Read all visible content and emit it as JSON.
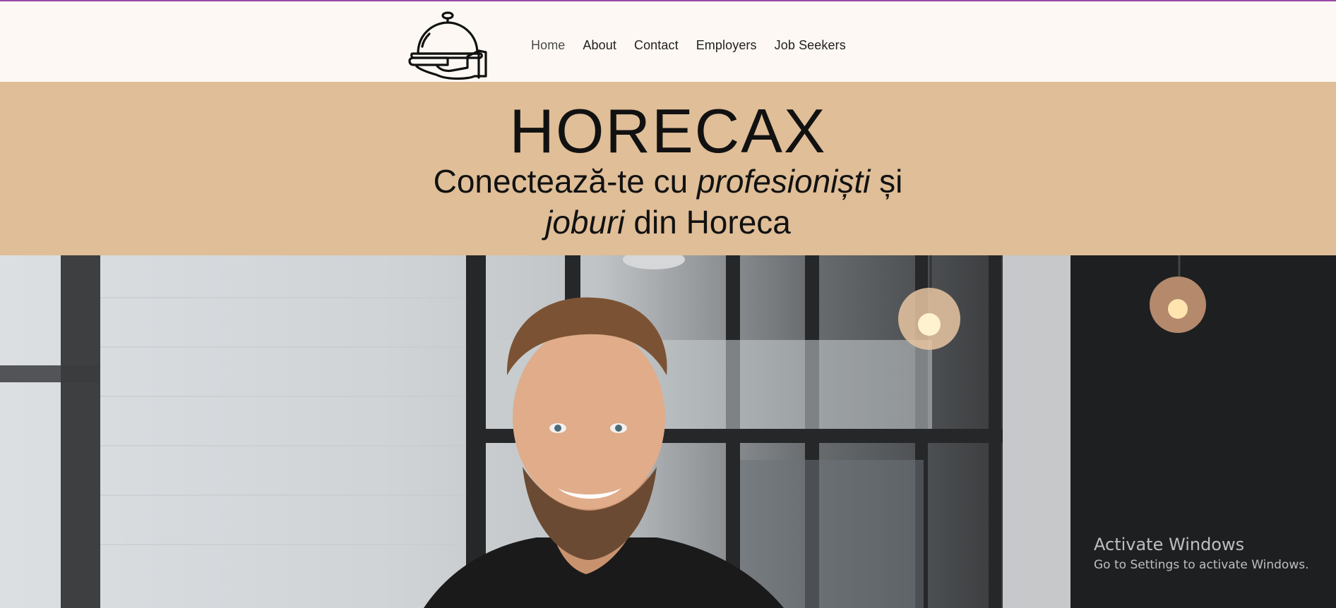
{
  "nav": {
    "items": [
      {
        "label": "Home",
        "active": true
      },
      {
        "label": "About",
        "active": false
      },
      {
        "label": "Contact",
        "active": false
      },
      {
        "label": "Employers",
        "active": false
      },
      {
        "label": "Job Seekers",
        "active": false
      }
    ]
  },
  "hero_band": {
    "title": "HORECAX",
    "tagline_part1": "Conectează-te cu ",
    "tagline_emph1": "profesioniști",
    "tagline_part2": " și",
    "tagline_emph2": "joburi",
    "tagline_part3": " din Horeca"
  },
  "watermark": {
    "title": "Activate Windows",
    "subtitle": "Go to Settings to activate Windows."
  },
  "colors": {
    "band": "#dfbe98",
    "header_bg": "#fdf8f3",
    "accent_line": "#9a4aa8"
  },
  "icons": {
    "logo": "cloche-serving-hand-icon"
  }
}
